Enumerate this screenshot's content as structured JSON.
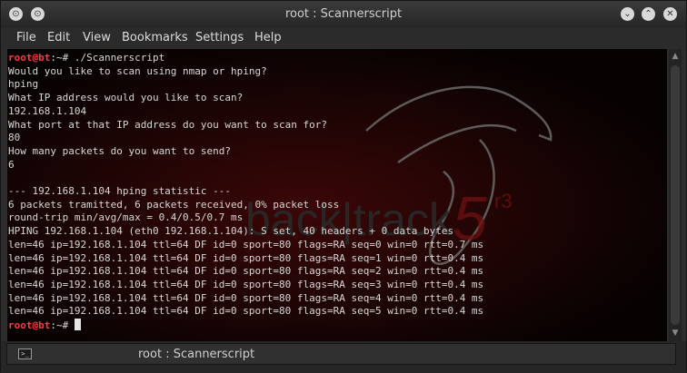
{
  "window": {
    "title": "root : Scannerscript",
    "buttons": {
      "settings_icon": "⊙",
      "minimize_icon": "⌄",
      "restore_icon": "⌃",
      "close_icon": "✕"
    }
  },
  "menu": [
    "File",
    "Edit",
    "View",
    "Bookmarks",
    "Settings",
    "Help"
  ],
  "terminal": {
    "prompt": {
      "user": "root@bt",
      "path": ":~# "
    },
    "lines": [
      {
        "prompt": true,
        "text": "./Scannerscript"
      },
      {
        "text": "Would you like to scan using nmap or hping?"
      },
      {
        "text": "hping"
      },
      {
        "text": "What IP address would you like to scan?"
      },
      {
        "text": "192.168.1.104"
      },
      {
        "text": "What port at that IP address do you want to scan for?"
      },
      {
        "text": "80"
      },
      {
        "text": "How many packets do you want to send?"
      },
      {
        "text": "6"
      },
      {
        "text": ""
      },
      {
        "text": "--- 192.168.1.104 hping statistic ---"
      },
      {
        "text": "6 packets tramitted, 6 packets received, 0% packet loss"
      },
      {
        "text": "round-trip min/avg/max = 0.4/0.5/0.7 ms"
      },
      {
        "text": "HPING 192.168.1.104 (eth0 192.168.1.104): S set, 40 headers + 0 data bytes"
      },
      {
        "text": "len=46 ip=192.168.1.104 ttl=64 DF id=0 sport=80 flags=RA seq=0 win=0 rtt=0.7 ms"
      },
      {
        "text": "len=46 ip=192.168.1.104 ttl=64 DF id=0 sport=80 flags=RA seq=1 win=0 rtt=0.4 ms"
      },
      {
        "text": "len=46 ip=192.168.1.104 ttl=64 DF id=0 sport=80 flags=RA seq=2 win=0 rtt=0.4 ms"
      },
      {
        "text": "len=46 ip=192.168.1.104 ttl=64 DF id=0 sport=80 flags=RA seq=3 win=0 rtt=0.4 ms"
      },
      {
        "text": "len=46 ip=192.168.1.104 ttl=64 DF id=0 sport=80 flags=RA seq=4 win=0 rtt=0.4 ms"
      },
      {
        "text": "len=46 ip=192.168.1.104 ttl=64 DF id=0 sport=80 flags=RA seq=5 win=0 rtt=0.4 ms"
      },
      {
        "prompt": true,
        "text": "",
        "cursor": true
      }
    ]
  },
  "wallpaper": {
    "logo_text": "back|track",
    "version": "5",
    "release": "r3",
    "dragon_icon": "dragon-icon"
  },
  "tab": {
    "title": "root : Scannerscript",
    "icon_glyph": ">_"
  },
  "colors": {
    "prompt_user": "#ff3b3b",
    "terminal_bg": "#050505",
    "text": "#d8d8d8",
    "wallpaper_red": "#5a0c0c"
  }
}
